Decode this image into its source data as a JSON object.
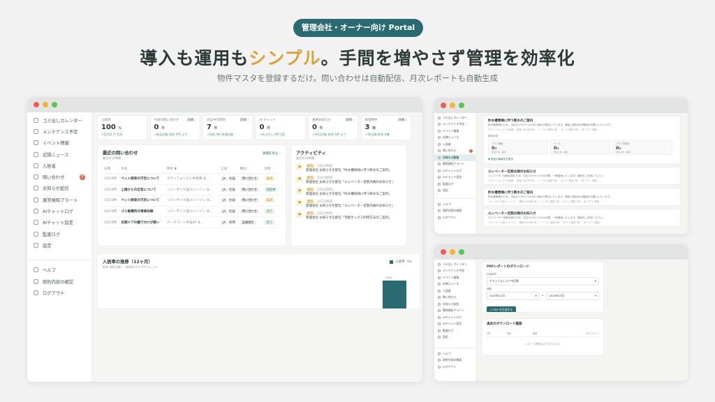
{
  "hero": {
    "badge": "管理会社・オーナー向け Portal",
    "headline_pre": "導入も運用も",
    "headline_highlight": "シンプル",
    "headline_post": "。手間を増やさず管理を効率化",
    "subline": "物件マスタを登録するだけ。問い合わせは自動配信、月次レポートも自動生成"
  },
  "colors": {
    "accent": "#2a6b71",
    "highlight": "#d9a23a",
    "badge_red": "#e06a4c"
  },
  "w1": {
    "sidebar": [
      {
        "label": "ゴミ出しカレンダー",
        "icon": "calendar-icon"
      },
      {
        "label": "メンテナンス予定",
        "icon": "wrench-icon"
      },
      {
        "label": "イベント情報",
        "icon": "event-icon"
      },
      {
        "label": "近隣ニュース",
        "icon": "news-icon"
      },
      {
        "label": "入居者",
        "icon": "user-icon"
      },
      {
        "label": "問い合わせ",
        "icon": "chat-icon",
        "badge": "7"
      },
      {
        "label": "お知らせ配信",
        "icon": "megaphone-icon"
      },
      {
        "label": "異常検知アラート",
        "icon": "alert-icon"
      },
      {
        "label": "AIチャットログ",
        "icon": "log-icon"
      },
      {
        "label": "AIチャット設定",
        "icon": "robot-icon"
      },
      {
        "label": "監査ログ",
        "icon": "audit-icon"
      },
      {
        "label": "設定",
        "icon": "gear-icon"
      }
    ],
    "sidebar_bottom": [
      {
        "label": "ヘルプ",
        "icon": "help-icon"
      },
      {
        "label": "契約内容の確認",
        "icon": "document-icon"
      },
      {
        "label": "ログアウト",
        "icon": "logout-icon"
      }
    ],
    "stats": [
      {
        "label": "入居率",
        "value": "100",
        "unit": "%",
        "sub": "↗22/22 戸 在住",
        "link": ""
      },
      {
        "label": "今週の問い合わせ",
        "value": "0",
        "unit": "件",
        "sub": "↗前日比較 前年 0件 より",
        "link": "詳細 ›"
      },
      {
        "label": "対応中の問合",
        "value": "7",
        "unit": "件",
        "sub": "↗対応 0件 前週比較",
        "link": "詳細 ›"
      },
      {
        "label": "AI チャット",
        "value": "0",
        "unit": "件",
        "sub": "→エスカレ 0件 2回",
        "link": ""
      },
      {
        "label": "重要お知らせ",
        "value": "0",
        "unit": "件",
        "sub": "↗30日比較 前年 0件 より",
        "link": "詳細 ›"
      },
      {
        "label": "管理物件",
        "value": "3",
        "unit": "棟",
        "sub": "↗30日間 前年 0棟",
        "link": "詳細 ›"
      }
    ],
    "inquiries": {
      "title": "最近の問い合わせ",
      "subtitle": "最近の14時間",
      "link": "詳細を見る ›",
      "columns": [
        "日時",
        "件名",
        "物件 ▼",
        "言語",
        "種別",
        "状態"
      ],
      "rows": [
        {
          "date": "1日10時",
          "subject": "ペット飼育の可否について",
          "property": "グランフォレスト中目黒 ヰ…",
          "lang": "JA",
          "type": "住居",
          "kind": "問い合わせ",
          "status": "未対",
          "sc": "y"
        },
        {
          "date": "1日10時",
          "subject": "上階からの足音について",
          "property": "リバーサイド品川ハーゾン ヰ…",
          "lang": "JA",
          "type": "住居",
          "kind": "問い合わせ",
          "status": "対応中",
          "sc": "b"
        },
        {
          "date": "1日10時",
          "subject": "ペット飼育の可否について",
          "property": "リバーサイド品川ハーゾン ヰ…",
          "lang": "JA",
          "type": "住居",
          "kind": "問い合わせ",
          "status": "未対",
          "sc": "y"
        },
        {
          "date": "1日10時",
          "subject": "ゴミ集積所の清掃依頼",
          "property": "リバーサイド品川ハーゾン ヰ…",
          "lang": "JA",
          "type": "住居",
          "kind": "問い合わせ",
          "status": "完了",
          "sc": "g"
        },
        {
          "date": "1日10時",
          "subject": "玄関ドアの鍵で付けが悪い",
          "property": "パークコート渋谷4F ヰ…",
          "lang": "JA",
          "type": "専用",
          "kind": "設備報告",
          "status": "完了",
          "sc": "g"
        }
      ]
    },
    "activity": {
      "title": "アクティビティ",
      "subtitle": "最近の14時間",
      "items": [
        {
          "tag": "配信",
          "time": "1日10時前",
          "text": "管理会社 お知らせを配信「貯水槽清掃に伴う断水のご案内」"
        },
        {
          "tag": "配信",
          "time": "1日10時前",
          "text": "管理会社 お知らせを配信「エレベーター定期点検のお知らせ」"
        },
        {
          "tag": "配信",
          "time": "1日10時前",
          "text": "管理会社 お知らせを配信「貯水槽清掃に伴う断水のご案内」"
        },
        {
          "tag": "配信",
          "time": "1日10時前",
          "text": "管理会社 お知らせを配信「エレベーター定期点検のお知らせ」"
        },
        {
          "tag": "配信",
          "time": "1日10時前",
          "text": "管理会社 お知らせを配信「宅配ボックス利用方法のご案内」"
        }
      ]
    },
    "chart": {
      "title": "入居率の推移（12ヶ月）",
      "subtitle": "前年 前月比較 ・ 前前月チャプチャレット",
      "legend": "入居率（%）",
      "label": "100%"
    }
  },
  "w2": {
    "sidebar": [
      "ゴミ出しカレンダー",
      "メンテナンス予定",
      "イベント情報",
      "近隣ニュース",
      "入居者",
      "問い合わせ",
      "お知らせ配信",
      "異常検知アラート",
      "AIチャットログ",
      "AIチャット設定",
      "監査ログ",
      "設定"
    ],
    "active": "お知らせ配信",
    "sidebar_bottom": [
      "ヘルプ",
      "契約内容の確認",
      "ログアウト"
    ],
    "notice1": {
      "title": "貯水槽清掃に伴う断水のご案内",
      "body": "貯水槽清掃のため、当日の13:00〜15:00に断水が発生いたします。事前に飲料水の確保をお願いいたします。",
      "meta": "グランフォレスト中目黒 ・ 配信 2025年3月 ・ ノーマル 配信 5件 ・ 日 + 1 配信 5件 ・ 本 アプリ 配信 ›"
    },
    "dispatch_label": "配信状況",
    "minis": [
      {
        "label": "アプリ通知",
        "value": "0",
        "unit": "件",
        "sub": "配信 0件 / 開封"
      },
      {
        "label": "メール",
        "value": "0",
        "unit": "件",
        "sub": "配信 0件 / 開封"
      },
      {
        "label": "アプリ内表示",
        "value": "0",
        "unit": "件",
        "sub": "配信 0件 / 開封"
      }
    ],
    "toggle": "▼ 配信の明細を非表示",
    "notices": [
      {
        "title": "エレベーター定期点検のお知らせ",
        "body": "エレベーター定期点検のため、当日10:00〜15:00の間、一時運休いたします。階段をご利用ください。",
        "meta": "グランフォレスト中目黒 ・ 配信 2025年3月 ・ ノーマル 配信 5件 ・ 日 + 1 配信 5件 ・ 本 アプリ 配信 ›"
      },
      {
        "title": "貯水槽清掃に伴う断水のご案内",
        "body": "貯水槽清掃のため、当日の13:00〜15:00に断水が発生いたします。事前に飲料水の確保をお願いいたします。",
        "meta": "リバーサイド品川ハーゾン ・ 配信 2025年3月 ・ ノーマル 配信 5件 ・ 日 + 1 配信 5件 ・ 本 アプリ 配信 ›"
      },
      {
        "title": "エレベーター定期点検のお知らせ",
        "body": "エレベーター定期点検のため、当日10:00〜15:00の間、一時運休いたします。階段をご利用ください。",
        "meta": "リバーサイド品川ハーゾン ・ 配信 2025年3月 ・ ノーマル 配信 5件 ・ 日 + 1 配信 5件 ・ 本 アプリ 配信 ›"
      }
    ]
  },
  "w3": {
    "sidebar": [
      "ゴミ出しカレンダー",
      "メンテナンス予定",
      "イベント情報",
      "近隣ニュース",
      "入居者",
      "問い合わせ",
      "お知らせ配信",
      "異常検知アラート",
      "AIチャットログ",
      "AIチャット設定",
      "監査ログ",
      "設定"
    ],
    "sidebar_bottom": [
      "ヘルプ",
      "契約内容の確認",
      "ログアウト"
    ],
    "download": {
      "title": "PDFレポートのダウンロード",
      "property_label": "対象物件",
      "property_value": "グランフォレスト中目黒",
      "period_label": "期間",
      "from": "2025年10月",
      "tilde": "〜",
      "to": "2025年10月",
      "button": "↓ PDF を生成する"
    },
    "history": {
      "title": "過去のダウンロード履歴",
      "columns": [
        "日付",
        "物件",
        "期間",
        "",
        "ダウンロード"
      ],
      "empty": "レポート履歴はまだありません"
    }
  }
}
